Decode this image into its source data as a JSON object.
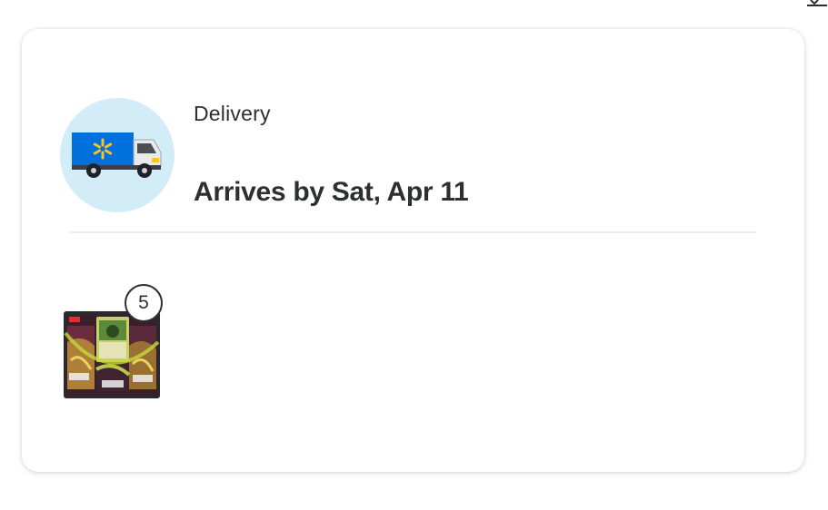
{
  "delivery": {
    "method_label": "Delivery",
    "arrival_text": "Arrives by Sat, Apr 11",
    "truck_icon": "delivery-truck-icon"
  },
  "items": [
    {
      "quantity": "5",
      "image_icon": "trading-card-pack-image"
    }
  ],
  "colors": {
    "circle_bg": "#d2ecf8",
    "truck_blue": "#0071dc",
    "spark_yellow": "#ffc220",
    "text": "#2e2f32"
  }
}
